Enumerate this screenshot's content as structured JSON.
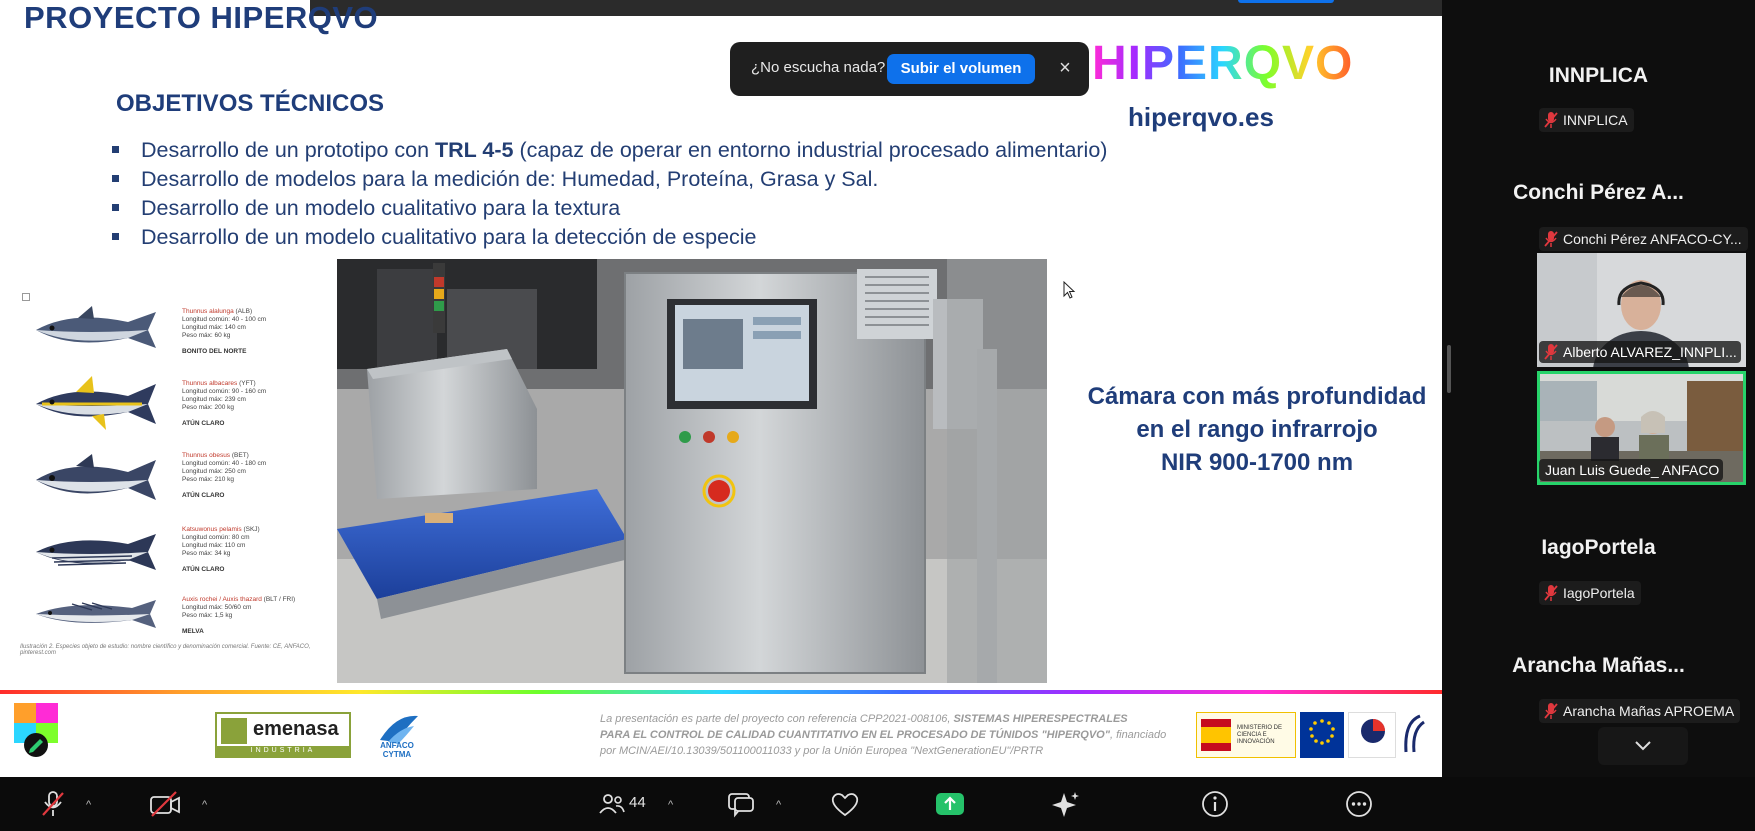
{
  "toast": {
    "question": "¿No escucha nada?",
    "action": "Subir el volumen",
    "close": "×"
  },
  "slide": {
    "title": "PROYECTO HIPERQVO",
    "subtitle": "OBJETIVOS TÉCNICOS",
    "bullets": [
      {
        "pre": "Desarrollo de un prototipo con ",
        "bold": "TRL 4-5",
        "post": " (capaz de operar en entorno industrial procesado alimentario)"
      },
      {
        "pre": "Desarrollo de modelos para la medición de: Humedad, Proteína, Grasa y Sal.",
        "bold": "",
        "post": ""
      },
      {
        "pre": "Desarrollo de un modelo cualitativo para la textura",
        "bold": "",
        "post": ""
      },
      {
        "pre": "Desarrollo de un modelo cualitativo para la detección de especie",
        "bold": "",
        "post": ""
      }
    ],
    "brand_logo": "HIPERQVO",
    "brand_url": "hiperqvo.es",
    "camera_lines": [
      "Cámara con más profundidad",
      "en el rango infrarrojo",
      "NIR 900-1700 nm"
    ],
    "fish": [
      {
        "name": "Thunnus alalunga",
        "code": "(ALB)",
        "lines": [
          "Longitud común: 40 - 100 cm",
          "Longitud máx: 140 cm",
          "Peso máx: 60 kg"
        ],
        "category": "BONITO DEL NORTE"
      },
      {
        "name": "Thunnus albacares",
        "code": "(YFT)",
        "lines": [
          "Longitud común: 90 - 160 cm",
          "Longitud máx: 239 cm",
          "Peso máx: 200 kg"
        ],
        "category": "ATÚN CLARO"
      },
      {
        "name": "Thunnus obesus",
        "code": "(BET)",
        "lines": [
          "Longitud común: 40 - 180 cm",
          "Longitud máx: 250 cm",
          "Peso máx: 210 kg"
        ],
        "category": "ATÚN CLARO"
      },
      {
        "name": "Katsuwonus pelamis",
        "code": "(SKJ)",
        "lines": [
          "Longitud común: 80 cm",
          "Longitud máx: 110 cm",
          "Peso máx: 34 kg"
        ],
        "category": "ATÚN CLARO"
      },
      {
        "name": "Auxis rochei / Auxis thazard",
        "code": "(BLT / FRI)",
        "lines": [
          "Longitud máx: 50/60 cm",
          "Peso máx: 1,5 kg"
        ],
        "category": "MELVA"
      }
    ],
    "fish_caption": "Ilustración 2. Especies objeto de estudio: nombre científico y denominación comercial. Fuente: CE, ANFACO, pinterest.com",
    "footer": {
      "emenasa_name": "emenasa",
      "emenasa_band": "INDUSTRIA",
      "anfaco_name": "ANFACO",
      "anfaco_sub": "CYTMA",
      "note_1": "La presentación es parte del proyecto con referencia CPP2021-008106, ",
      "note_1_bold": "SISTEMAS HIPERESPECTRALES",
      "note_2_bold": "PARA EL CONTROL DE CALIDAD CUANTITATIVO EN EL PROCESADO DE TÚNIDOS \"HIPERQVO\"",
      "note_2": ", financiado",
      "note_3": "por MCIN/AEI/10.13039/501100011033 y por la Unión Europea \"NextGenerationEU\"/PRTR",
      "ministry": "MINISTERIO DE CIENCIA E INNOVACIÓN",
      "eu": "Financiado por la Unión Europea NextGenerationEU",
      "prtr": "Plan de Recuperación, Transformación y Resiliencia",
      "aei": "AGENCIA ESTATAL DE INVESTIGACIÓN"
    }
  },
  "participants": [
    {
      "name": "INNPLICA",
      "tag": "INNPLICA"
    },
    {
      "name": "Conchi Pérez A...",
      "tag": "Conchi Pérez ANFACO-CY..."
    },
    {
      "video_label": "Alberto ALVAREZ_INNPLI..."
    },
    {
      "video_label": "Juan Luis Guede_ ANFACO"
    },
    {
      "name": "IagoPortela",
      "tag": "IagoPortela"
    },
    {
      "name": "Arancha  Mañas...",
      "tag": "Arancha Mañas APROEMA"
    }
  ],
  "toolbar": {
    "participant_count": "44"
  },
  "colors": {
    "slide_navy": "#1f3d7a",
    "toast_blue": "#0e71eb",
    "active_speaker": "#27d36a",
    "muted_red": "#e0383e"
  }
}
